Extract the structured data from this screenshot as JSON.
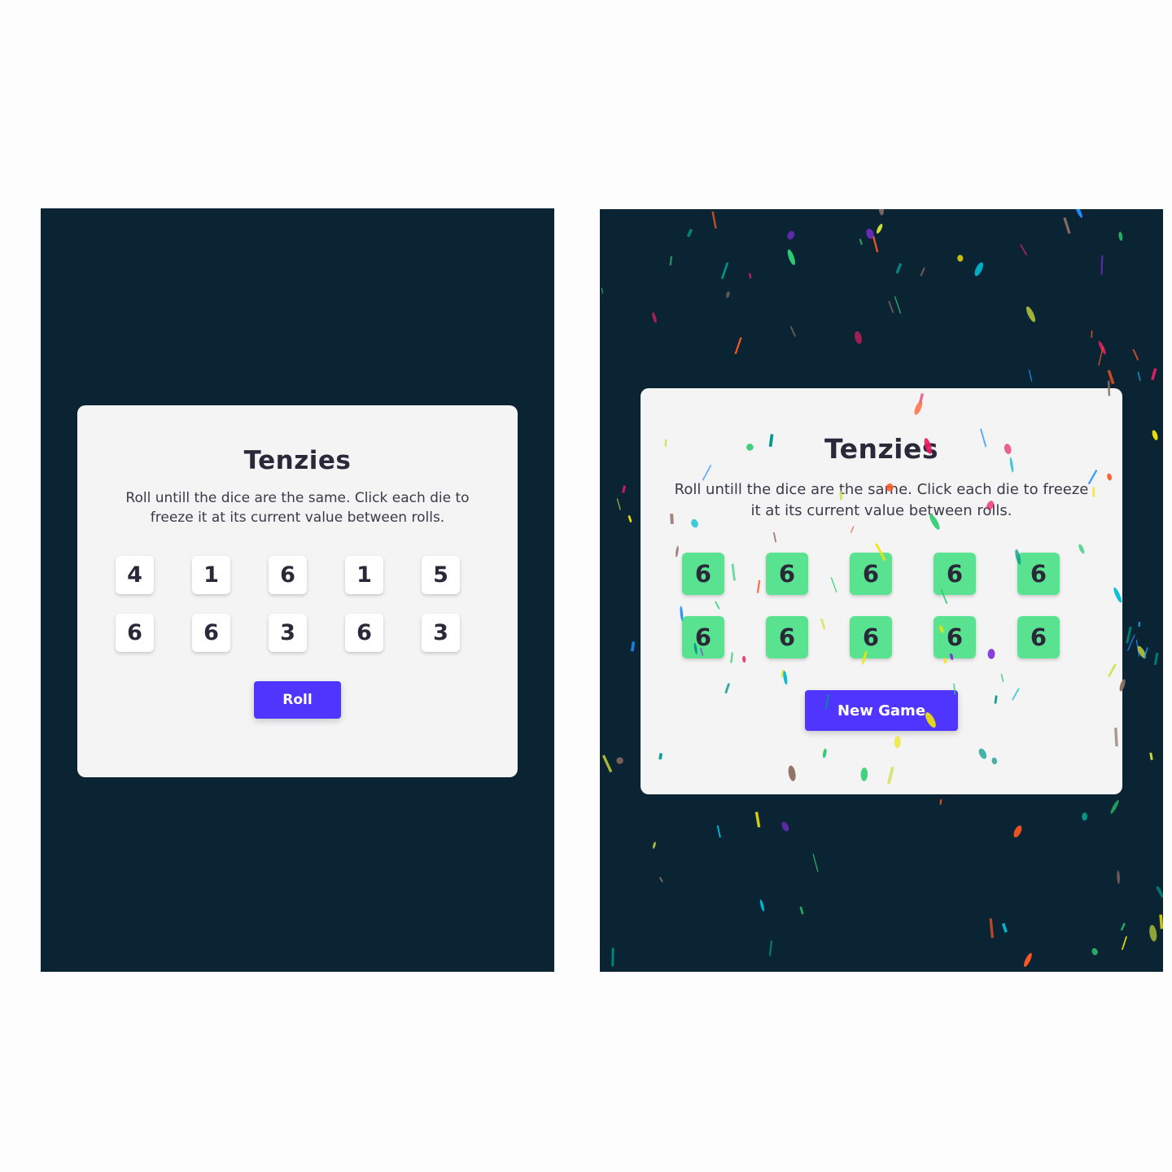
{
  "left_screen": {
    "title": "Tenzies",
    "instructions": "Roll untill the dice are the same. Click each die to freeze it at its current value between rolls.",
    "dice": [
      {
        "value": "4",
        "held": false
      },
      {
        "value": "1",
        "held": false
      },
      {
        "value": "6",
        "held": false
      },
      {
        "value": "1",
        "held": false
      },
      {
        "value": "5",
        "held": false
      },
      {
        "value": "6",
        "held": false
      },
      {
        "value": "6",
        "held": false
      },
      {
        "value": "3",
        "held": false
      },
      {
        "value": "6",
        "held": false
      },
      {
        "value": "3",
        "held": false
      }
    ],
    "button_label": "Roll"
  },
  "right_screen": {
    "title": "Tenzies",
    "instructions": "Roll untill the dice are the same. Click each die to freeze it at its current value between rolls.",
    "dice": [
      {
        "value": "6",
        "held": true
      },
      {
        "value": "6",
        "held": true
      },
      {
        "value": "6",
        "held": true
      },
      {
        "value": "6",
        "held": true
      },
      {
        "value": "6",
        "held": true
      },
      {
        "value": "6",
        "held": true
      },
      {
        "value": "6",
        "held": true
      },
      {
        "value": "6",
        "held": true
      },
      {
        "value": "6",
        "held": true
      },
      {
        "value": "6",
        "held": true
      }
    ],
    "button_label": "New Game",
    "confetti_colors": [
      "#f2e307",
      "#1e90ff",
      "#7b2cd6",
      "#2ecc71",
      "#ff5722",
      "#e91e63",
      "#00bcd4",
      "#8d6e63",
      "#009688",
      "#cddc39"
    ]
  },
  "colors": {
    "background": "#0b2434",
    "card": "#f4f4f5",
    "die": "#ffffff",
    "die_held": "#59e391",
    "button": "#5035ff"
  }
}
